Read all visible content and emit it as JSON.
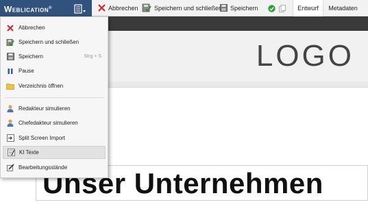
{
  "brand": {
    "name": "Weblication",
    "mark": "®"
  },
  "toolbar": {
    "cancel_label": "Abbrechen",
    "save_close_label": "Speichern und schließen",
    "save_label": "Speichern"
  },
  "tabs": [
    {
      "label": "Entwurf",
      "active": true
    },
    {
      "label": "Metadaten",
      "active": false
    }
  ],
  "page": {
    "logo_text": "LOGO",
    "heading": "Unser Unternehmen"
  },
  "menu": {
    "items": [
      {
        "label": "Abbrechen",
        "icon": "cancel-icon"
      },
      {
        "label": "Speichern und schließen",
        "icon": "save-close-icon"
      },
      {
        "label": "Speichern",
        "shortcut": "Strg + S",
        "icon": "save-icon"
      },
      {
        "label": "Pause",
        "icon": "pause-icon"
      },
      {
        "label": "Verzeichnis öffnen",
        "icon": "folder-icon"
      },
      {
        "label": "Redakteur simulieren",
        "icon": "user-icon"
      },
      {
        "label": "Chefedakteur simulieren",
        "icon": "user-icon"
      },
      {
        "label": "Split Screen Import",
        "icon": "import-icon"
      },
      {
        "label": "KI Texte",
        "icon": "ai-text-icon",
        "highlighted": true
      },
      {
        "label": "Bearbeitungsstände",
        "icon": "edit-history-icon"
      }
    ]
  },
  "colors": {
    "brand_bg": "#31527c",
    "cancel_red": "#d9262b",
    "save_green": "#3d8b2f",
    "check_green": "#2e9c3a",
    "dark_bar": "#3a3a3a"
  }
}
